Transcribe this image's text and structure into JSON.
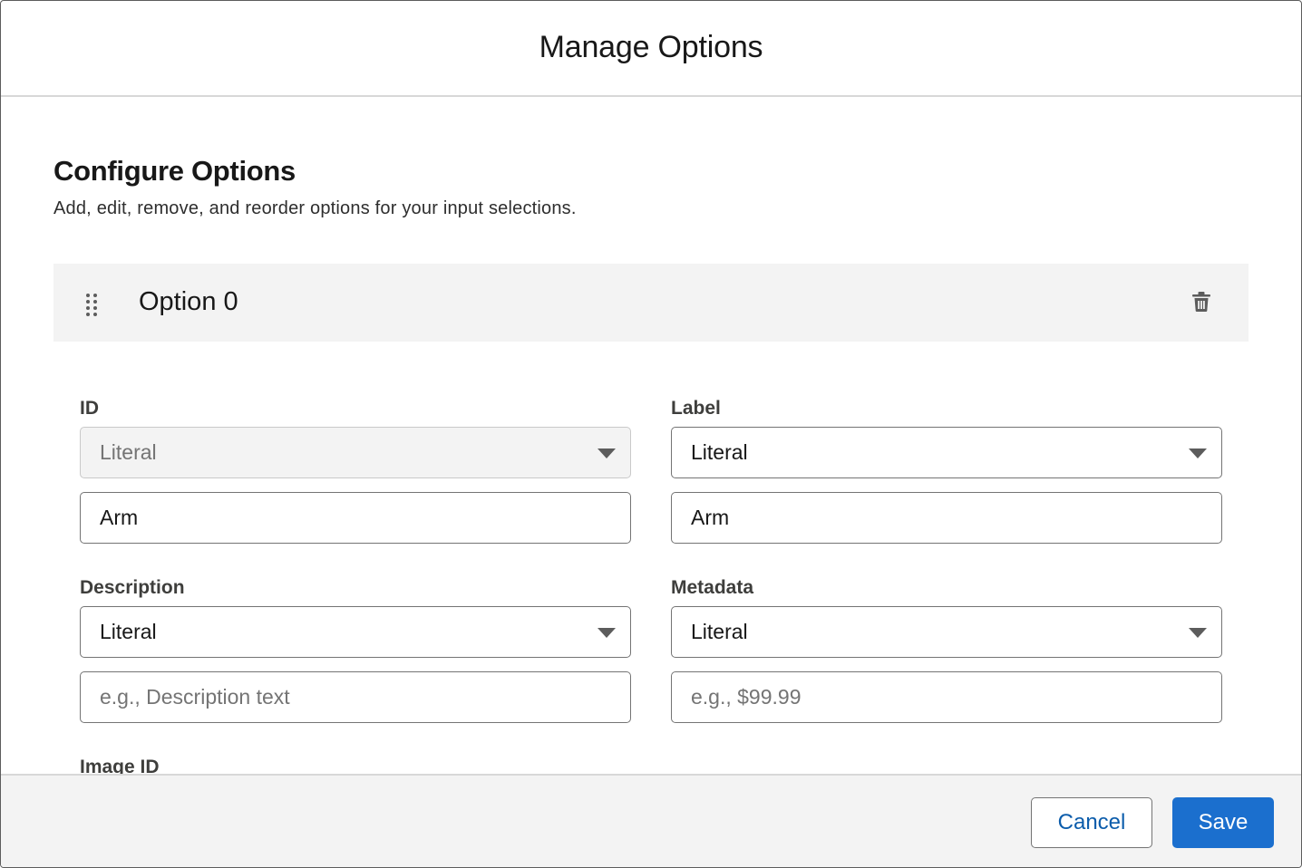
{
  "modal": {
    "title": "Manage Options"
  },
  "section": {
    "title": "Configure Options",
    "description": "Add, edit, remove, and reorder options for your input selections."
  },
  "option": {
    "title": "Option 0",
    "icons": {
      "drag": "drag-handle-icon",
      "delete": "trash-icon"
    },
    "fields": {
      "id": {
        "label": "ID",
        "type_value": "Literal",
        "type_disabled": true,
        "value": "Arm"
      },
      "label": {
        "label": "Label",
        "type_value": "Literal",
        "value": "Arm"
      },
      "description": {
        "label": "Description",
        "type_value": "Literal",
        "value": "",
        "placeholder": "e.g., Description text"
      },
      "metadata": {
        "label": "Metadata",
        "type_value": "Literal",
        "value": "",
        "placeholder": "e.g., $99.99"
      },
      "image_id": {
        "label": "Image ID"
      }
    }
  },
  "footer": {
    "cancel_label": "Cancel",
    "save_label": "Save"
  },
  "colors": {
    "primary": "#1b6fce",
    "link": "#0b5cab",
    "panel_bg": "#f3f3f3",
    "border": "#747474"
  }
}
